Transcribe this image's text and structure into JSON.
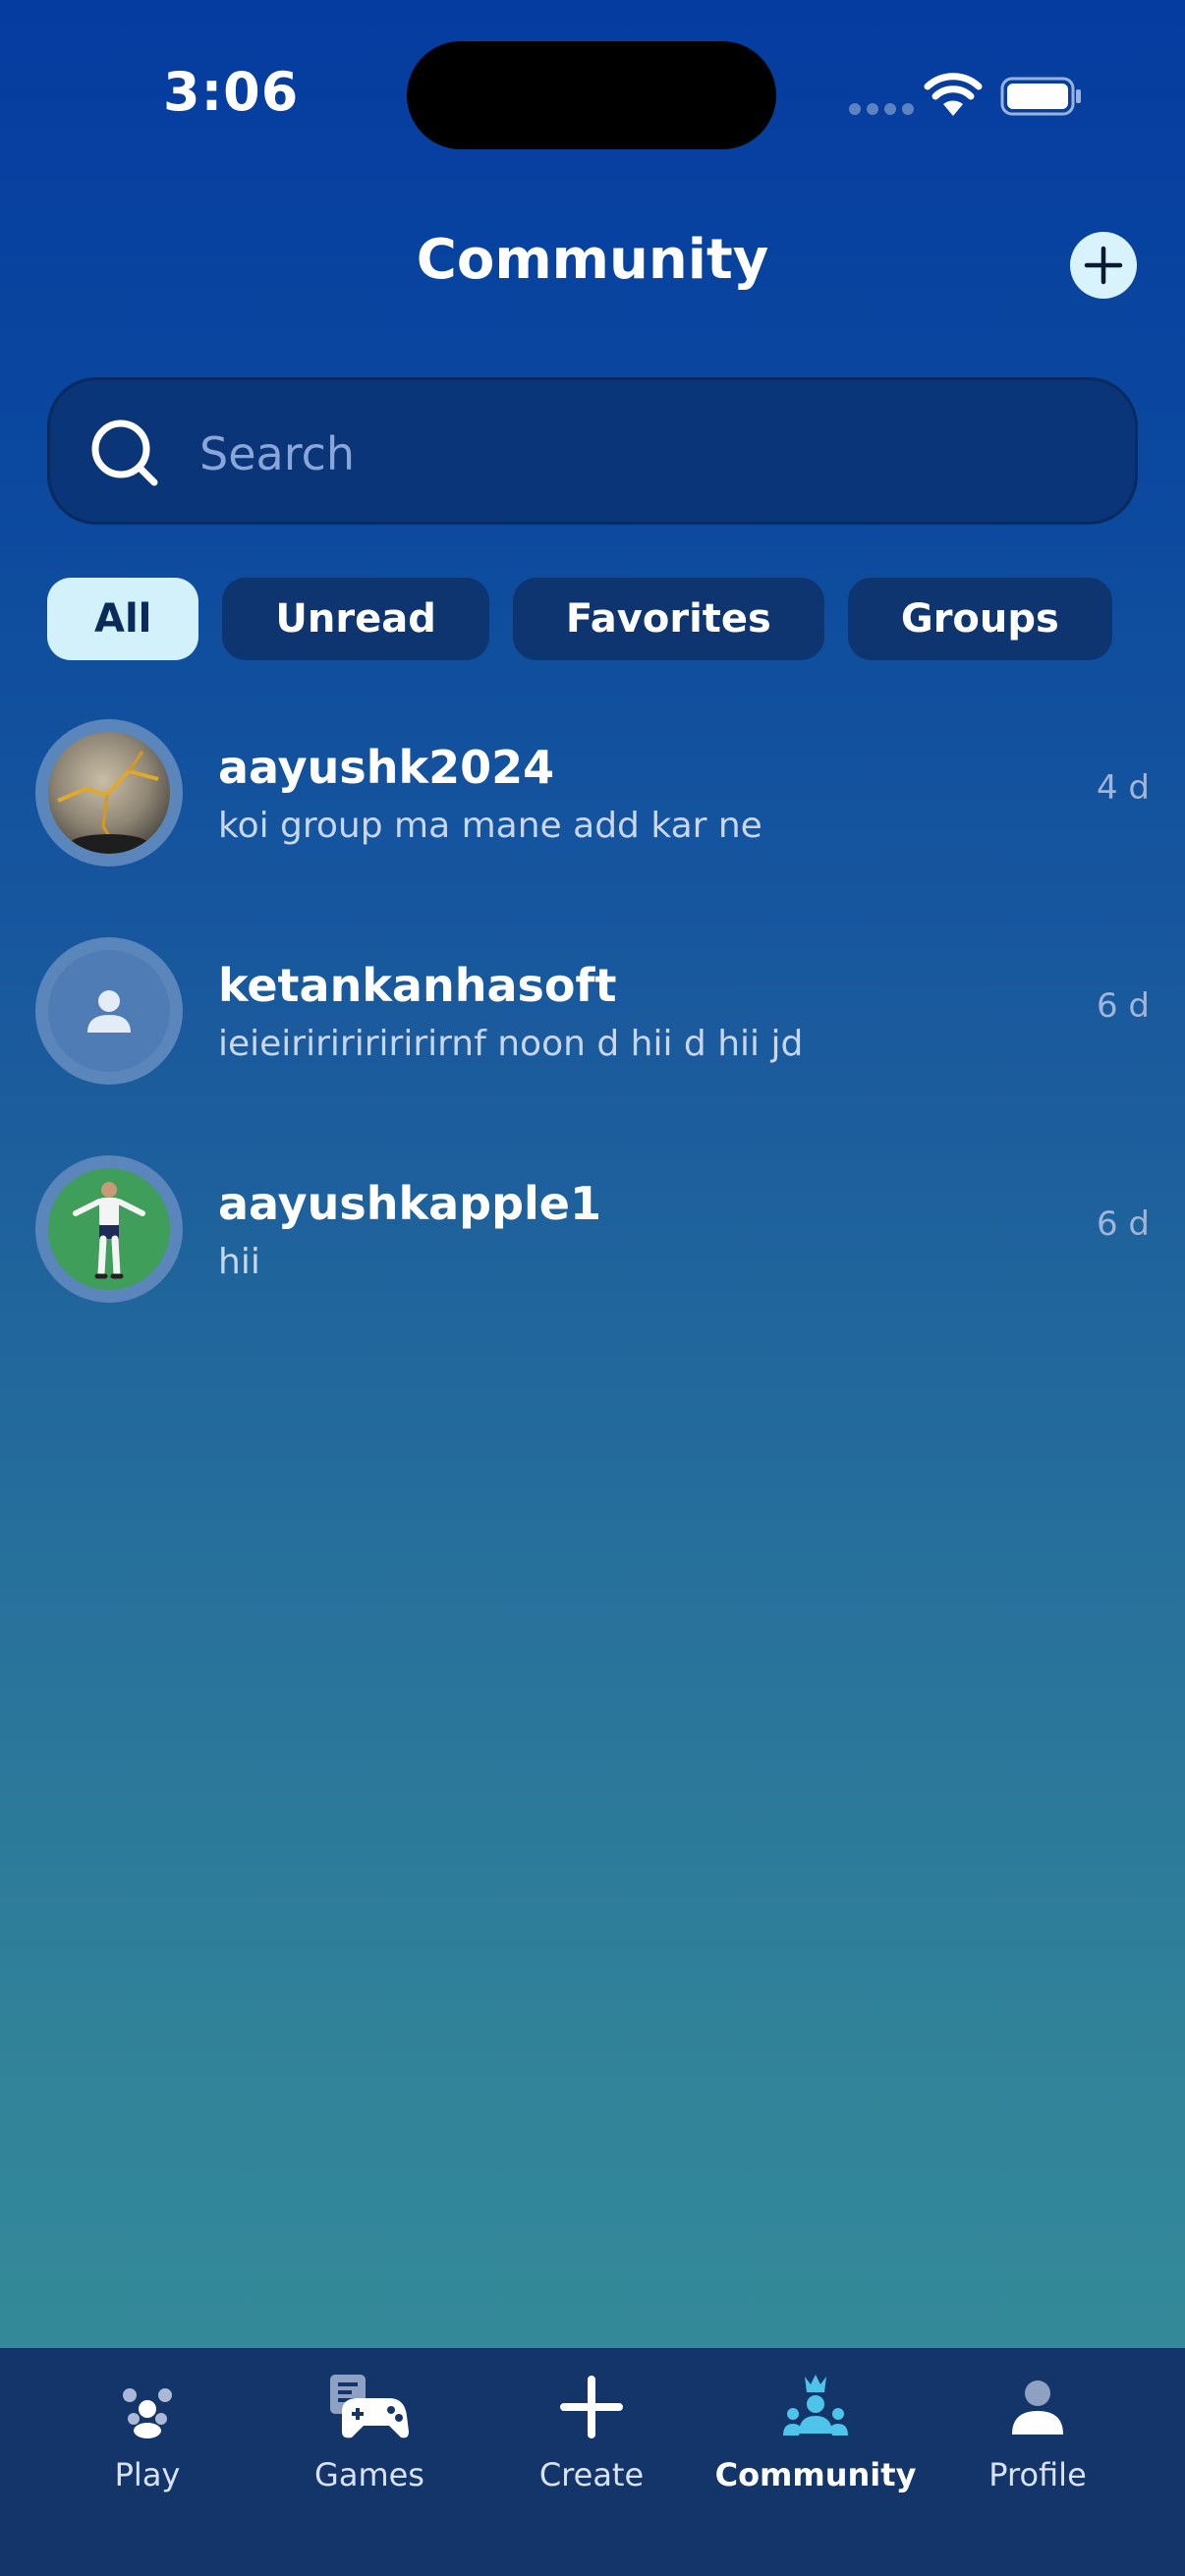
{
  "status_bar": {
    "time": "3:06"
  },
  "header": {
    "title": "Community"
  },
  "search": {
    "placeholder": "Search"
  },
  "filters": [
    {
      "label": "All",
      "active": true
    },
    {
      "label": "Unread",
      "active": false
    },
    {
      "label": "Favorites",
      "active": false
    },
    {
      "label": "Groups",
      "active": false
    }
  ],
  "conversations": [
    {
      "name": "aayushk2024",
      "message": "koi group ma mane add kar ne",
      "time": "4 d",
      "avatar": "photo-avatar"
    },
    {
      "name": "ketankanhasoft",
      "message": "ieieiririririririrnf noon d hii d hii jd",
      "time": "6 d",
      "avatar": "default-person-avatar"
    },
    {
      "name": "aayushkapple1",
      "message": "hii",
      "time": "6 d",
      "avatar": "player-avatar"
    }
  ],
  "tabbar": [
    {
      "label": "Play",
      "icon": "people-icon"
    },
    {
      "label": "Games",
      "icon": "gamepad-icon"
    },
    {
      "label": "Create",
      "icon": "plus-icon"
    },
    {
      "label": "Community",
      "icon": "crown-people-icon",
      "active": true
    },
    {
      "label": "Profile",
      "icon": "person-icon"
    }
  ],
  "colors": {
    "accent": "#d2f1fb",
    "active_tab_icon": "#4fc4ea",
    "tab_bar": "#143569"
  }
}
